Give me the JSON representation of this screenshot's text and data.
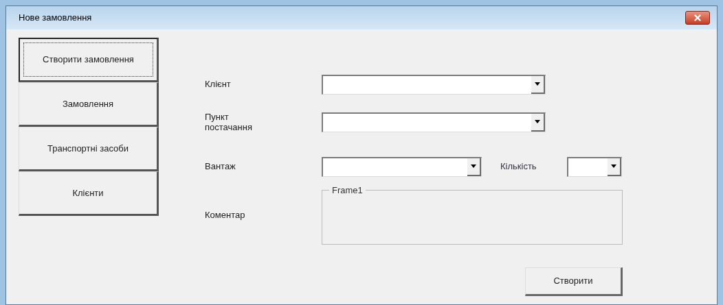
{
  "window": {
    "title": "Нове замовлення"
  },
  "nav": [
    {
      "label": "Створити замовлення",
      "selected": true
    },
    {
      "label": "Замовлення",
      "selected": false
    },
    {
      "label": "Транспортні засоби",
      "selected": false
    },
    {
      "label": "Клієнти",
      "selected": false
    }
  ],
  "form": {
    "client": {
      "label": "Клієнт"
    },
    "delivery_point": {
      "label": "Пункт постачання"
    },
    "cargo": {
      "label": "Вантаж"
    },
    "quantity": {
      "label": "Кількість"
    },
    "comment": {
      "label": "Коментар",
      "frame_caption": "Frame1"
    }
  },
  "buttons": [
    "Створити"
  ]
}
